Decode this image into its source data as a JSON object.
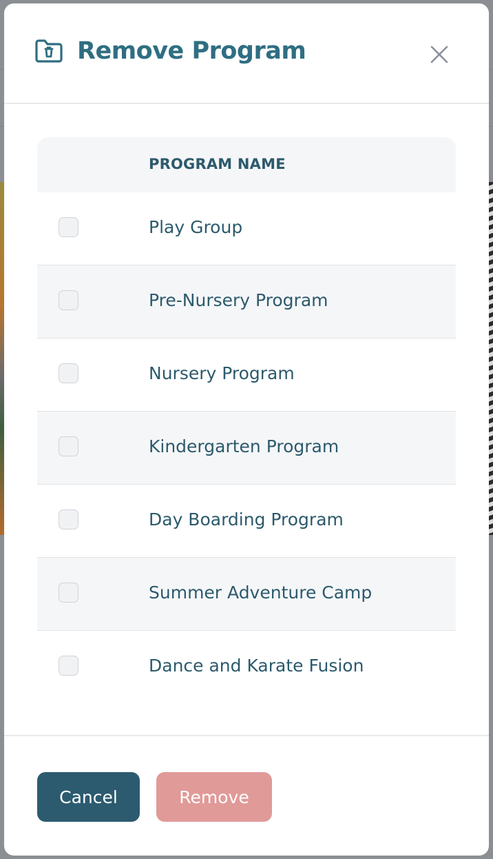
{
  "modal": {
    "title": "Remove Program",
    "header_icon": "folder-trash-icon",
    "close_icon": "close-icon"
  },
  "table": {
    "column_header": "PROGRAM NAME",
    "rows": [
      {
        "label": "Play Group",
        "checked": false
      },
      {
        "label": "Pre-Nursery Program",
        "checked": false
      },
      {
        "label": "Nursery Program",
        "checked": false
      },
      {
        "label": "Kindergarten Program",
        "checked": false
      },
      {
        "label": "Day Boarding Program",
        "checked": false
      },
      {
        "label": "Summer Adventure Camp",
        "checked": false
      },
      {
        "label": "Dance and Karate Fusion",
        "checked": false
      }
    ]
  },
  "footer": {
    "cancel_label": "Cancel",
    "remove_label": "Remove"
  },
  "colors": {
    "title": "#2f6e82",
    "text": "#2c5a6c",
    "cancel_bg": "#2c5b70",
    "remove_bg_disabled": "#e09a98",
    "row_alt_bg": "#f5f6f8"
  }
}
